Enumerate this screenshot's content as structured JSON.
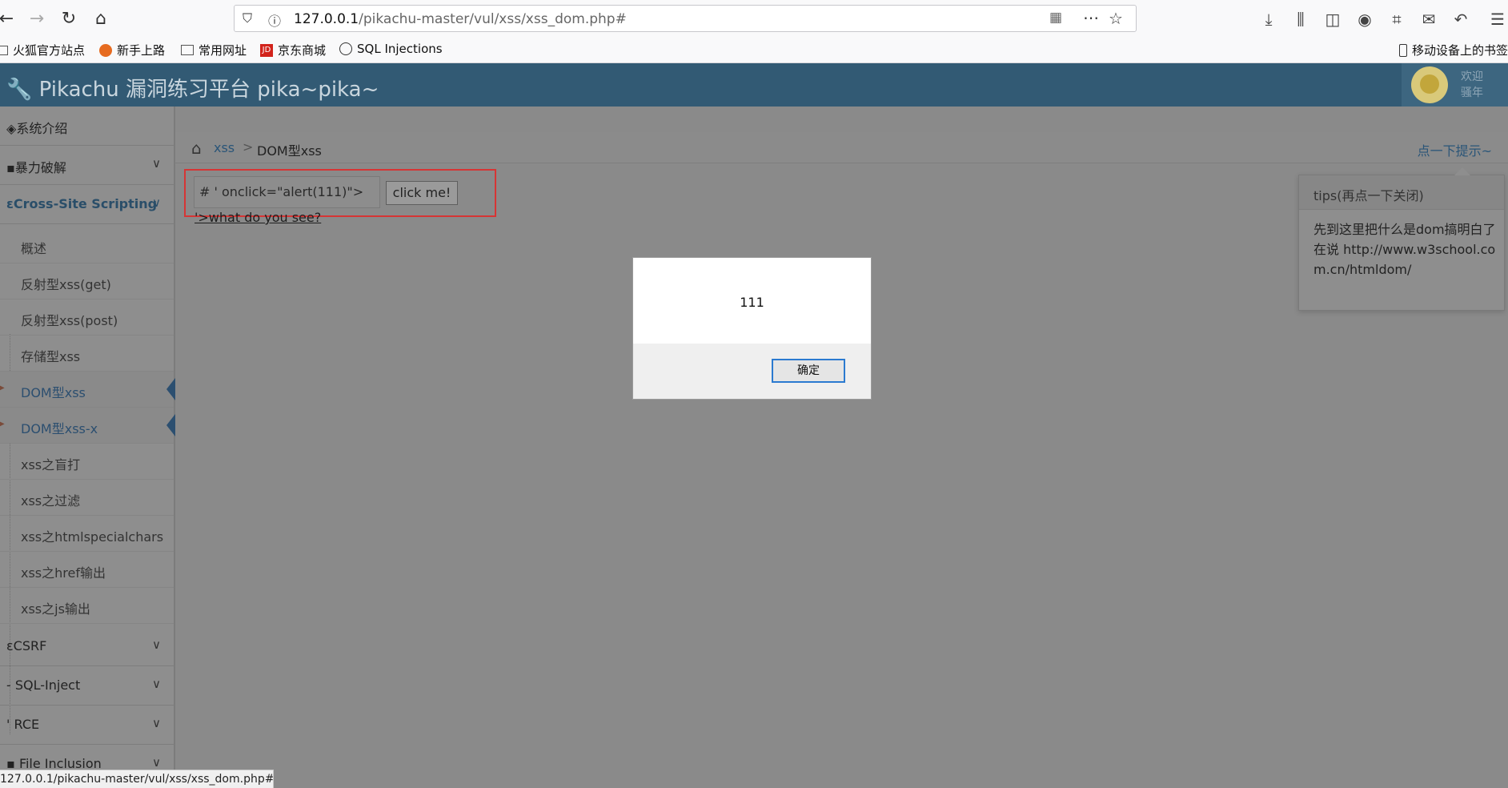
{
  "browser": {
    "url_host": "127.0.0.1",
    "url_path": "/pikachu-master/vul/xss/xss_dom.php#",
    "bookmarks": [
      "火狐官方站点",
      "新手上路",
      "常用网址",
      "京东商城",
      "SQL Injections"
    ],
    "mobile_bookmarks": "移动设备上的书签",
    "status_url": "127.0.0.1/pikachu-master/vul/xss/xss_dom.php#"
  },
  "header": {
    "title": "Pikachu 漏洞练习平台 pika~pika~",
    "welcome": "欢迎",
    "welcome2": "骚年"
  },
  "sidebar": {
    "top_items": [
      {
        "label": "系统介绍"
      },
      {
        "label": "暴力破解"
      },
      {
        "label": "Cross-Site Scripting"
      },
      {
        "label": "CSRF"
      },
      {
        "label": "SQL-Inject"
      },
      {
        "label": "RCE"
      },
      {
        "label": "File Inclusion"
      }
    ],
    "sub_items": [
      {
        "label": "概述"
      },
      {
        "label": "反射型xss(get)"
      },
      {
        "label": "反射型xss(post)"
      },
      {
        "label": "存储型xss"
      },
      {
        "label": "DOM型xss"
      },
      {
        "label": "DOM型xss-x"
      },
      {
        "label": "xss之盲打"
      },
      {
        "label": "xss之过滤"
      },
      {
        "label": "xss之htmlspecialchars"
      },
      {
        "label": "xss之href输出"
      },
      {
        "label": "xss之js输出"
      }
    ]
  },
  "breadcrumb": {
    "section": "xss",
    "separator": ">",
    "current": "DOM型xss",
    "tip_link": "点一下提示~"
  },
  "main": {
    "input_value": "# ' onclick=\"alert(111)\">",
    "button_label": "click me!",
    "what_link": "'>what do you see?"
  },
  "tips": {
    "title": "tips(再点一下关闭)",
    "body": "先到这里把什么是dom搞明白了在说 http://www.w3school.com.cn/htmldom/"
  },
  "dialog": {
    "message": "111",
    "ok_label": "确定"
  }
}
